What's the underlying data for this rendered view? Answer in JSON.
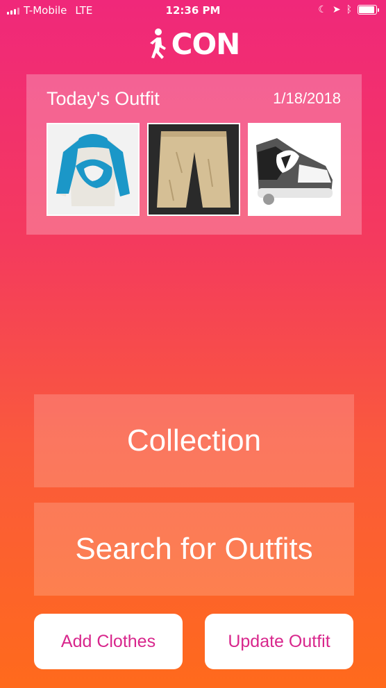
{
  "status_bar": {
    "carrier": "T-Mobile",
    "network": "LTE",
    "time": "12:36 PM"
  },
  "app": {
    "logo_text": "CON",
    "icons": {
      "logo": "walking-person-icon",
      "status": [
        "moon-icon",
        "location-arrow-icon",
        "bluetooth-icon",
        "battery-icon"
      ]
    }
  },
  "outfit": {
    "title": "Today's Outfit",
    "date": "1/18/2018",
    "items": [
      {
        "name": "hoodie-image"
      },
      {
        "name": "pants-image"
      },
      {
        "name": "shoe-image"
      }
    ]
  },
  "actions": {
    "collection": "Collection",
    "search": "Search for Outfits",
    "add_clothes": "Add Clothes",
    "update_outfit": "Update Outfit"
  },
  "colors": {
    "gradient_top": "#f0287a",
    "gradient_bottom": "#ff6a1c",
    "button_text": "#d8268c"
  }
}
